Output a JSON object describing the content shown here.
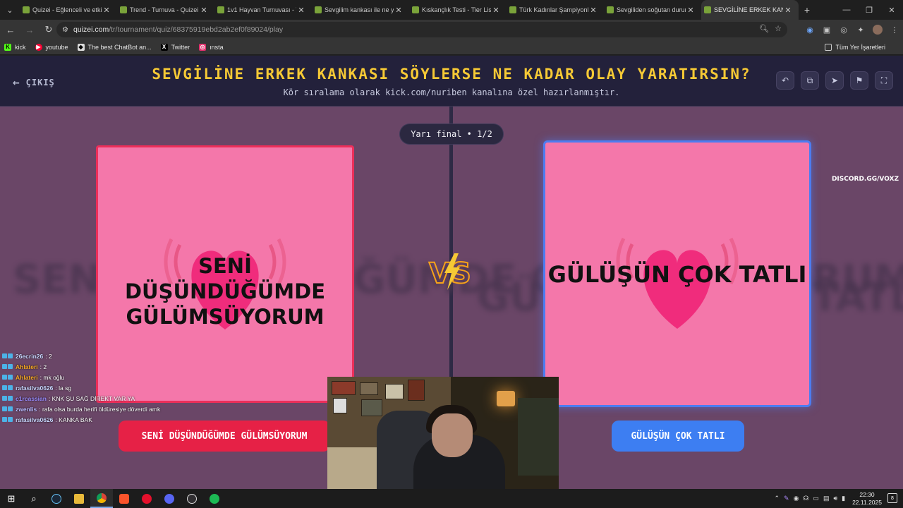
{
  "browser": {
    "tabs": [
      {
        "label": "Quizei - Eğlenceli ve etkil",
        "active": false
      },
      {
        "label": "Trend - Turnuva - Quizei",
        "active": false
      },
      {
        "label": "1v1 Hayvan Turnuvası - T",
        "active": false
      },
      {
        "label": "Sevgilim kankası ile ne ya",
        "active": false
      },
      {
        "label": "Kıskançlık Testi - Tier List",
        "active": false
      },
      {
        "label": "Türk Kadınlar Şampiyonla",
        "active": false
      },
      {
        "label": "Sevgiliden soğutan durum",
        "active": false
      },
      {
        "label": "SEVGİLİNE ERKEK KANKA",
        "active": true
      }
    ],
    "url_host": "quizei.com",
    "url_path": "/tr/tournament/quiz/68375919ebd2ab2ef0f89024/play",
    "bookmarks": [
      {
        "label": "kick",
        "icon": "kick-icon",
        "color": "#53fc18"
      },
      {
        "label": "youtube",
        "icon": "youtube-icon",
        "color": "#ff0033"
      },
      {
        "label": "The best ChatBot an...",
        "icon": "chatbot-icon",
        "color": "#ffffff"
      },
      {
        "label": "Twitter",
        "icon": "x-icon",
        "color": "#000000"
      },
      {
        "label": "ınsta",
        "icon": "instagram-icon",
        "color": "#e1306c"
      }
    ],
    "all_bookmarks": "Tüm Yer İşaretleri"
  },
  "quiz": {
    "exit_label": "ÇIKIŞ",
    "title": "SEVGİLİNE ERKEK KANKASI SÖYLERSE NE KADAR OLAY YARATIRSIN?",
    "subtitle": "Kör sıralama olarak kick.com/nuriben kanalına özel hazırlanmıştır.",
    "round": "Yarı final • 1/2",
    "left_option": {
      "card_text": "SENİ DÜŞÜNDÜĞÜMDE GÜLÜMSÜYORUM",
      "button_label": "SENİ DÜŞÜNDÜĞÜMDE GÜLÜMSÜYORUM"
    },
    "right_option": {
      "card_text": "GÜLÜŞÜN ÇOK TATLI",
      "button_label": "GÜLÜŞÜN ÇOK TATLI"
    },
    "vs_label": "VS",
    "colors": {
      "title": "#f6c935",
      "left_accent": "#e62146",
      "right_accent": "#3d7ef2",
      "card_bg": "#f477aa"
    }
  },
  "overlay": {
    "discord": "DISCORD.GG/VOXZ",
    "chat": [
      {
        "user": "26ecrin26",
        "message": ": 2",
        "color": "#c9d7ff"
      },
      {
        "user": "Ahlateri",
        "message": ": 2",
        "color": "#f7a823"
      },
      {
        "user": "Ahlateri",
        "message": ": mk oğlu",
        "color": "#f7a823"
      },
      {
        "user": "rafasilva0626",
        "message": ": la sg",
        "color": "#c9d7ff"
      },
      {
        "user": "c1rcassian",
        "message": ": KNK ŞU SAĞ DİREKT VAR YA",
        "color": "#9b8cff"
      },
      {
        "user": "zwenlis",
        "message": ": rafa olsa burda herifi öldüresiye döverdi amk",
        "color": "#b9b9ff"
      },
      {
        "user": "rafasilva0626",
        "message": ": KANKA BAK",
        "color": "#c9d7ff"
      }
    ]
  },
  "taskbar": {
    "time": "22:30",
    "date": "22.11.2025",
    "notifications": "8"
  }
}
